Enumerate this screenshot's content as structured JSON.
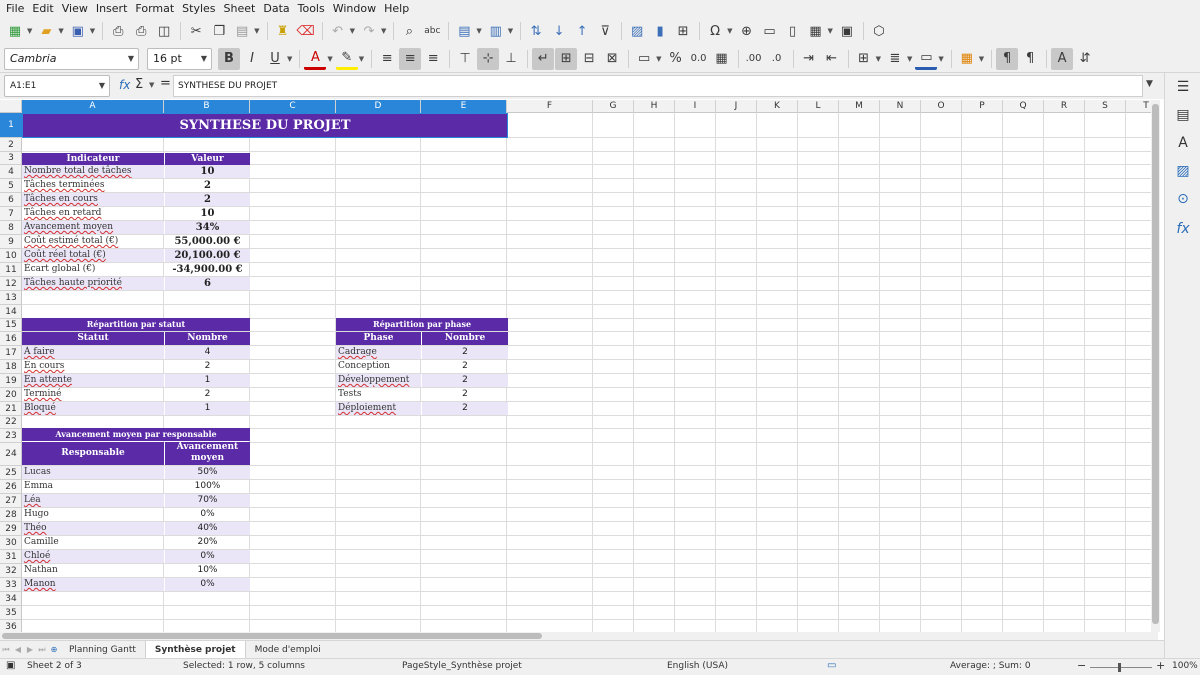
{
  "menu": [
    "File",
    "Edit",
    "View",
    "Insert",
    "Format",
    "Styles",
    "Sheet",
    "Data",
    "Tools",
    "Window",
    "Help"
  ],
  "toolbar": {
    "font_name": "Cambria",
    "font_size": "16 pt",
    "bold": "B",
    "italic": "I",
    "underline": "U",
    "percent": "%",
    "decimal_format": "0.0",
    "add_decimal": ".00",
    "del_decimal": ".0"
  },
  "formula_bar": {
    "name_box": "A1:E1",
    "formula_value": "SYNTHESE DU PROJET",
    "fx": "fx",
    "sigma": "Σ",
    "equals": "="
  },
  "columns": [
    "A",
    "B",
    "C",
    "D",
    "E",
    "F",
    "G",
    "H",
    "I",
    "J",
    "K",
    "L",
    "M",
    "N",
    "O",
    "P",
    "Q",
    "R",
    "S",
    "T"
  ],
  "rows": [
    "1",
    "2",
    "3",
    "4",
    "5",
    "6",
    "7",
    "8",
    "9",
    "10",
    "11",
    "12",
    "13",
    "14",
    "15",
    "16",
    "17",
    "18",
    "19",
    "20",
    "21",
    "22",
    "23",
    "24",
    "25",
    "26",
    "27",
    "28",
    "29",
    "30",
    "31",
    "32",
    "33",
    "34",
    "35",
    "36"
  ],
  "sheet": {
    "title": "SYNTHESE DU PROJET",
    "summary": {
      "header_label": "Indicateur",
      "header_value": "Valeur",
      "items": [
        {
          "label": "Nombre total de tâches",
          "value": "10"
        },
        {
          "label": "Tâches terminées",
          "value": "2"
        },
        {
          "label": "Tâches en cours",
          "value": "2"
        },
        {
          "label": "Tâches en retard",
          "value": "10"
        },
        {
          "label": "Avancement moyen",
          "value": "34%"
        },
        {
          "label": "Coût estimé total (€)",
          "value": "55,000.00 €"
        },
        {
          "label": "Coût réel total (€)",
          "value": "20,100.00 €"
        },
        {
          "label": "Écart global (€)",
          "value": "-34,900.00 €"
        },
        {
          "label": "Tâches haute priorité",
          "value": "6"
        }
      ]
    },
    "by_status": {
      "title": "Répartition par statut",
      "header_label": "Statut",
      "header_value": "Nombre",
      "items": [
        {
          "label": "À faire",
          "value": "4"
        },
        {
          "label": "En cours",
          "value": "2"
        },
        {
          "label": "En attente",
          "value": "1"
        },
        {
          "label": "Terminé",
          "value": "2"
        },
        {
          "label": "Bloqué",
          "value": "1"
        }
      ]
    },
    "by_phase": {
      "title": "Répartition par phase",
      "header_label": "Phase",
      "header_value": "Nombre",
      "items": [
        {
          "label": "Cadrage",
          "value": "2"
        },
        {
          "label": "Conception",
          "value": "2"
        },
        {
          "label": "Développement",
          "value": "2"
        },
        {
          "label": "Tests",
          "value": "2"
        },
        {
          "label": "Déploiement",
          "value": "2"
        }
      ]
    },
    "by_owner": {
      "title": "Avancement moyen par responsable",
      "header_label": "Responsable",
      "header_value": "Avancement moyen",
      "items": [
        {
          "label": "Lucas",
          "value": "50%"
        },
        {
          "label": "Emma",
          "value": "100%"
        },
        {
          "label": "Léa",
          "value": "70%"
        },
        {
          "label": "Hugo",
          "value": "0%"
        },
        {
          "label": "Théo",
          "value": "40%"
        },
        {
          "label": "Camille",
          "value": "20%"
        },
        {
          "label": "Chloé",
          "value": "0%"
        },
        {
          "label": "Nathan",
          "value": "10%"
        },
        {
          "label": "Manon",
          "value": "0%"
        }
      ]
    }
  },
  "tabs": [
    "Planning Gantt",
    "Synthèse projet",
    "Mode d'emploi"
  ],
  "active_tab": "Synthèse projet",
  "status": {
    "sheet": "Sheet 2 of 3",
    "selection": "Selected: 1 row, 5 columns",
    "page_style": "PageStyle_Synthèse projet",
    "language": "English (USA)",
    "sum": "Average: ; Sum: 0",
    "zoom": "100%",
    "zoom_minus": "−",
    "zoom_plus": "+"
  },
  "colors": {
    "header_purple": "#5b2aa6",
    "band_lavender": "#ebe6f7",
    "selection_blue": "#2a86d8"
  }
}
